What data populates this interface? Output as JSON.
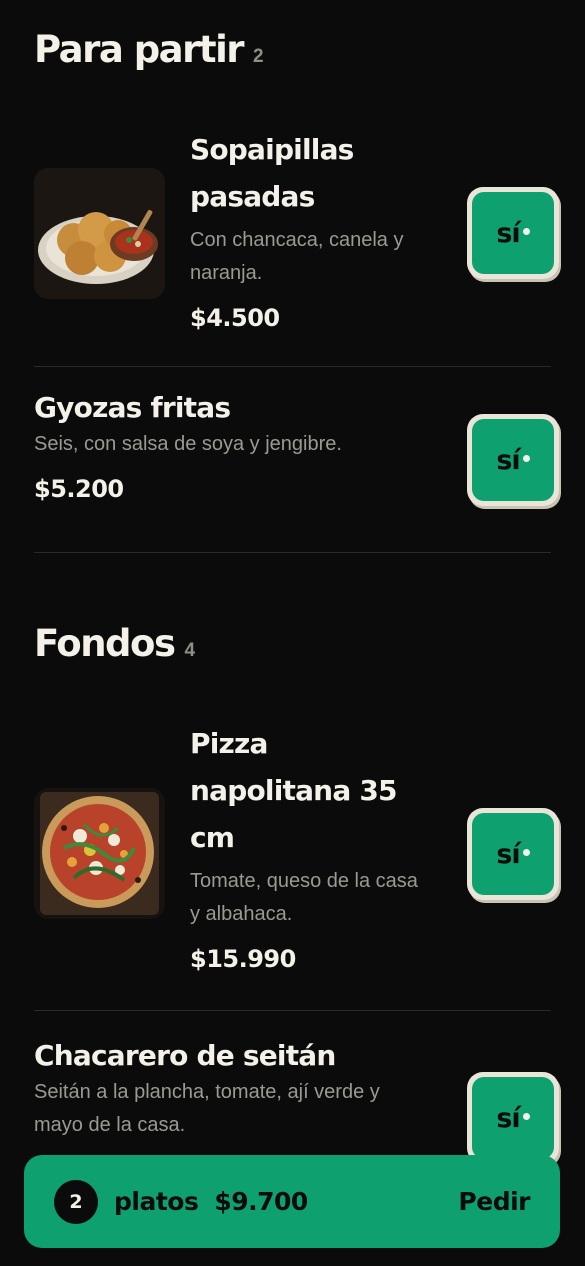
{
  "sections": [
    {
      "title": "Para partir",
      "count": "2",
      "items": [
        {
          "name_lines": [
            "Sopaipillas",
            "pasadas"
          ],
          "description_lines": [
            "Con chancaca, canela y",
            "naranja."
          ],
          "price": "$4.500",
          "image": "sopaipillas-photo",
          "button": "sí"
        },
        {
          "name_lines": [
            "Gyozas fritas"
          ],
          "description_lines": [
            "Seis, con salsa de soya y jengibre."
          ],
          "price": "$5.200",
          "button": "sí"
        }
      ]
    },
    {
      "title": "Fondos",
      "count": "4",
      "items": [
        {
          "name_lines": [
            "Pizza",
            "napolitana 35",
            "cm"
          ],
          "description_lines": [
            "Tomate, queso de la casa",
            "y albahaca."
          ],
          "price": "$15.990",
          "image": "pizza-photo",
          "button": "sí"
        },
        {
          "name_lines": [
            "Chacarero de seitán"
          ],
          "description_lines": [
            "Seitán a la plancha, tomate, ají verde y",
            "mayo de la casa."
          ],
          "button": "sí"
        }
      ]
    }
  ],
  "cart": {
    "count": "2",
    "label": "platos",
    "total": "$9.700",
    "action": "Pedir"
  },
  "colors": {
    "background": "#0b0b0b",
    "accent": "#0ea16f",
    "text": "#f4f1e8",
    "muted": "#9a9a92"
  }
}
